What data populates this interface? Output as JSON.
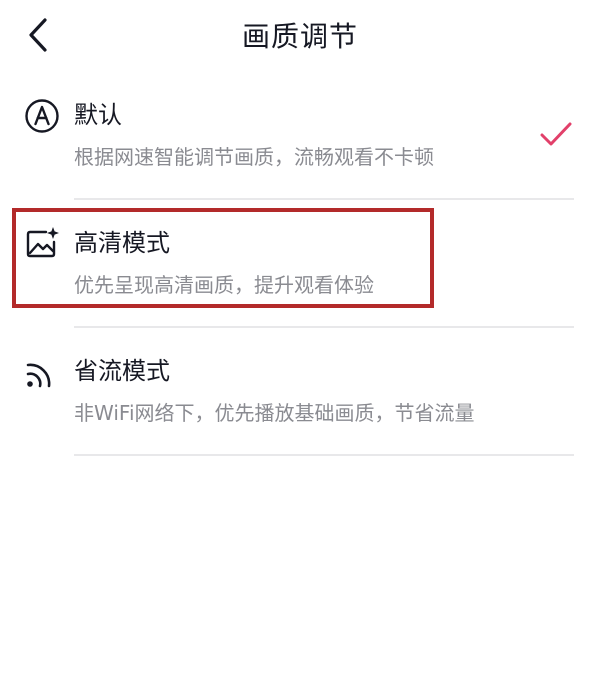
{
  "header": {
    "title": "画质调节",
    "back_icon": "chevron-left-icon"
  },
  "options": [
    {
      "id": "default",
      "icon": "auto-a-icon",
      "title": "默认",
      "desc": "根据网速智能调节画质，流畅观看不卡顿",
      "selected": true
    },
    {
      "id": "hd",
      "icon": "image-sparkle-icon",
      "title": "高清模式",
      "desc": "优先呈现高清画质，提升观看体验",
      "selected": false
    },
    {
      "id": "saver",
      "icon": "signal-waves-icon",
      "title": "省流模式",
      "desc": "非WiFi网络下，优先播放基础画质，节省流量",
      "selected": false
    }
  ],
  "colors": {
    "check": "#e2406a",
    "highlight": "#b32a2a",
    "title_text": "#161823",
    "desc_text": "#8a8b91",
    "divider": "#e8e8ea"
  }
}
